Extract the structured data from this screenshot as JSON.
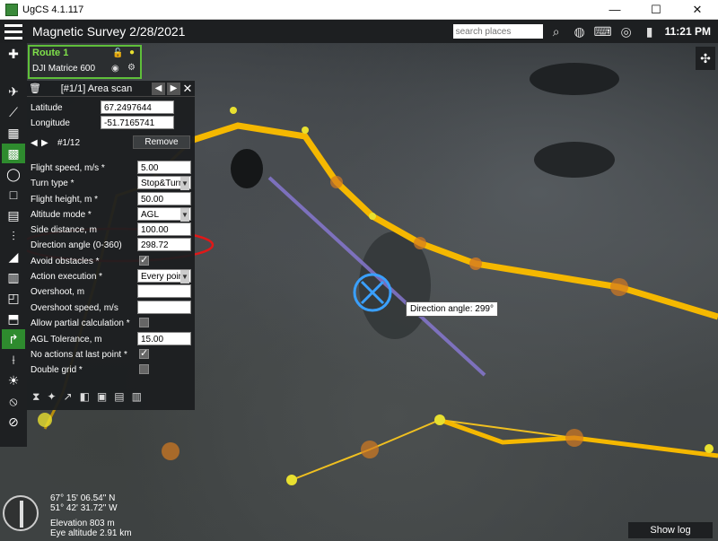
{
  "window": {
    "title": "UgCS 4.1.117",
    "minimize": "—",
    "maximize": "☐",
    "close": "✕"
  },
  "topbar": {
    "mission_title": "Magnetic Survey 2/28/2021",
    "search_placeholder": "search places",
    "clock": "11:21 PM"
  },
  "route": {
    "name": "Route 1",
    "drone": "DJI Matrice 600"
  },
  "panel": {
    "title": "[#1/1] Area scan",
    "latitude_label": "Latitude",
    "latitude_value": "67.2497644",
    "longitude_label": "Longitude",
    "longitude_value": "-51.7165741",
    "point_counter": "#1/12",
    "remove_label": "Remove",
    "fields": [
      {
        "label": "Flight speed, m/s *",
        "value": "5.00"
      },
      {
        "label": "Turn type *",
        "value": "Stop&Turn"
      },
      {
        "label": "Flight height, m *",
        "value": "50.00"
      },
      {
        "label": "Altitude mode *",
        "value": "AGL"
      },
      {
        "label": "Side distance, m",
        "value": "100.00"
      },
      {
        "label": "Direction angle (0-360)",
        "value": "298.72"
      },
      {
        "label": "Avoid obstacles *",
        "value": ""
      },
      {
        "label": "Action execution *",
        "value": "Every point"
      },
      {
        "label": "Overshoot, m",
        "value": ""
      },
      {
        "label": "Overshoot speed, m/s",
        "value": ""
      },
      {
        "label": "Allow partial calculation *",
        "value": ""
      },
      {
        "label": "AGL Tolerance, m",
        "value": "15.00"
      },
      {
        "label": "No actions at last point *",
        "value": ""
      },
      {
        "label": "Double grid *",
        "value": ""
      }
    ]
  },
  "map": {
    "tooltip": "Direction angle: 299°",
    "coord_lat": "67° 15' 06.54\" N",
    "coord_lon": "51° 42' 31.72\" W",
    "elevation": "Elevation 803 m",
    "eye_altitude": "Eye altitude 2.91 km",
    "show_log": "Show log"
  }
}
